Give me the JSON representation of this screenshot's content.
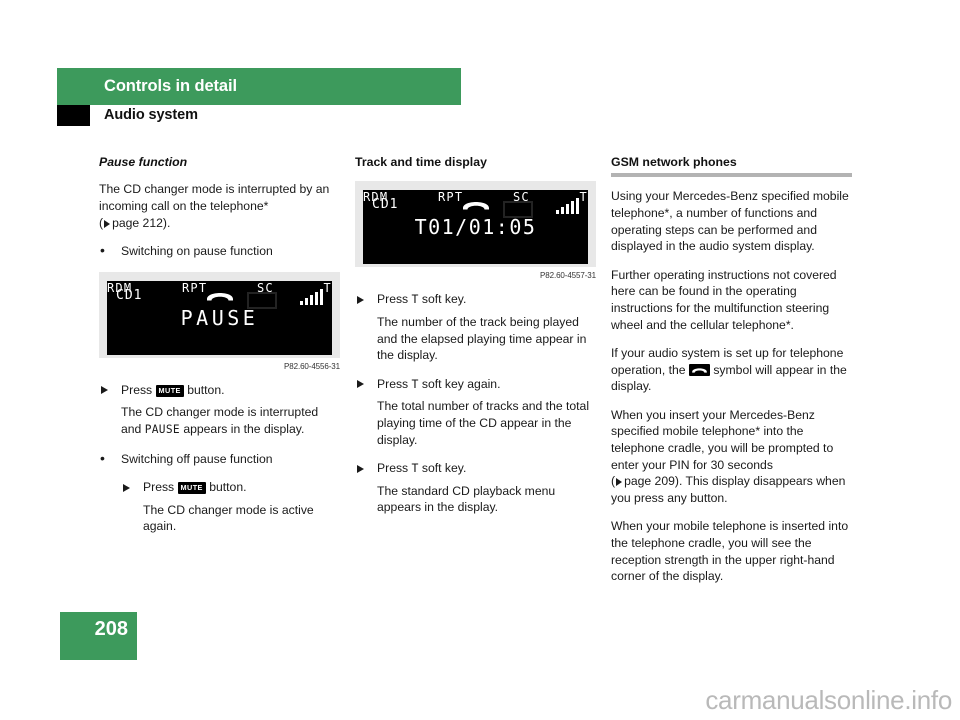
{
  "header": {
    "chapter": "Controls in detail",
    "section": "Audio system"
  },
  "columns": {
    "left": {
      "heading": "Pause function",
      "intro": "The CD changer mode is interrupted by an incoming call on the telephone*",
      "page_ref_open": "(",
      "page_ref_text": "page 212).",
      "bullet_on": "Switching on pause function",
      "display": {
        "cd_label": "CD1",
        "main_text": "PAUSE",
        "ghost_main": "         ",
        "soft_keys": [
          "RDM",
          "RPT",
          "SC",
          "T"
        ],
        "caption": "P82.60-4556-31"
      },
      "step_1_pre": "Press",
      "step_1_key": "MUTE",
      "step_1_post": "button.",
      "step_1_body_pre": "The CD changer mode is interrupted and",
      "step_1_body_mono": "PAUSE",
      "step_1_body_post": "appears in the display.",
      "bullet_off": "Switching off pause function",
      "step_2_pre": "Press",
      "step_2_key": "MUTE",
      "step_2_post": "button.",
      "step_2_body": "The CD changer mode is active again."
    },
    "middle": {
      "heading": "Track and time display",
      "display": {
        "cd_label": "CD1",
        "main_text": "T01/01:05",
        "soft_keys": [
          "RDM",
          "RPT",
          "SC",
          "T"
        ],
        "caption": "P82.60-4557-31"
      },
      "step_1_pre": "Press",
      "step_1_key": "T",
      "step_1_post": "soft key.",
      "step_1_body": "The number of the track being played and the elapsed playing time appear in the display.",
      "step_2_pre": "Press",
      "step_2_key": "T",
      "step_2_post": "soft key again.",
      "step_2_body": "The total number of tracks and the total playing time of the CD appear in the display.",
      "step_3_pre": "Press",
      "step_3_key": "T",
      "step_3_post": "soft key.",
      "step_3_body": "The standard CD playback menu appears in the display."
    },
    "right": {
      "heading": "GSM network phones",
      "para_1": "Using your Mercedes-Benz specified mobile telephone*, a number of functions and operating steps can be performed and displayed in the audio system display.",
      "para_2": "Further operating instructions not covered here can be found in the operating instructions for the multifunction steering wheel and the cellular telephone*.",
      "para_3_pre": "If your audio system is set up for telephone operation, the",
      "para_3_post": "symbol will appear in the display.",
      "para_4_pre": "When you insert your Mercedes-Benz specified mobile telephone* into the telephone cradle, you will be prompted to enter your PIN for 30 seconds",
      "para_4_ref_open": "(",
      "para_4_ref_text": "page 209). This display disappears when you press any button.",
      "para_5": "When your mobile telephone is inserted into the telephone cradle, you will see the reception strength in the upper right-hand corner of the display."
    }
  },
  "footer": {
    "page_number": "208",
    "watermark": "carmanualsonline.info"
  },
  "colors": {
    "brand_green": "#3d9a5c",
    "rule_gray": "#b3b3b3",
    "illustration_bg": "#e8e8e8"
  }
}
